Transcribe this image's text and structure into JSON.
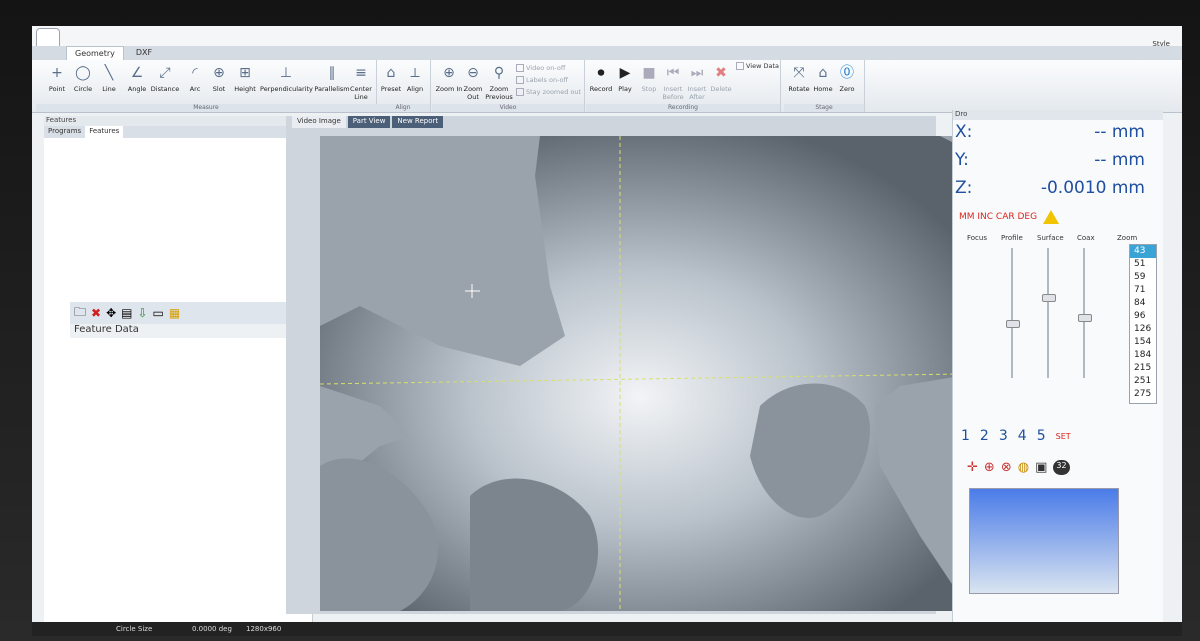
{
  "ribbon": {
    "tabs": [
      "Geometry",
      "DXF"
    ],
    "style_label": "Style",
    "groups": {
      "measure": {
        "title": "Measure",
        "tools": [
          "Point",
          "Circle",
          "Line",
          "Angle",
          "Distance",
          "Arc",
          "Slot",
          "Height",
          "Perpendicularity",
          "Parallelism",
          "Center Line"
        ]
      },
      "align": {
        "title": "Align",
        "tools": [
          "Preset",
          "Align"
        ]
      },
      "video": {
        "title": "Video",
        "tools": [
          "Zoom In",
          "Zoom Out",
          "Zoom Previous"
        ],
        "toggles": [
          "Video on-off",
          "Labels on-off",
          "Stay zoomed out"
        ]
      },
      "recording": {
        "title": "Recording",
        "tools": [
          "Record",
          "Play",
          "Stop",
          "Insert Before",
          "Insert After",
          "Delete"
        ],
        "view_data": "View Data"
      },
      "stage": {
        "title": "Stage",
        "tools": [
          "Rotate",
          "Home",
          "Zero"
        ]
      }
    }
  },
  "left_panel": {
    "title": "Features",
    "tabs": [
      "Programs",
      "Features"
    ],
    "feature_data_title": "Feature Data"
  },
  "center": {
    "tabs": [
      "Video Image",
      "Part View",
      "New Report"
    ]
  },
  "dro": {
    "title": "Dro",
    "x": {
      "label": "X:",
      "value": "-- mm"
    },
    "y": {
      "label": "Y:",
      "value": "-- mm"
    },
    "z": {
      "label": "Z:",
      "value": "-0.0010 mm"
    },
    "modes": "MM INC CAR DEG",
    "lights": [
      "Focus",
      "Profile",
      "Surface",
      "Coax"
    ],
    "zoom_label": "Zoom",
    "zoom_values": [
      "43",
      "51",
      "59",
      "71",
      "84",
      "96",
      "126",
      "154",
      "184",
      "215",
      "251",
      "275"
    ],
    "zoom_selected": "43",
    "presets": [
      "1",
      "2",
      "3",
      "4",
      "5"
    ],
    "set_label": "SET",
    "camera_badge": "32"
  },
  "status": {
    "circle_size_label": "Circle Size",
    "angle": "0.0000 deg",
    "resolution": "1280x960"
  }
}
